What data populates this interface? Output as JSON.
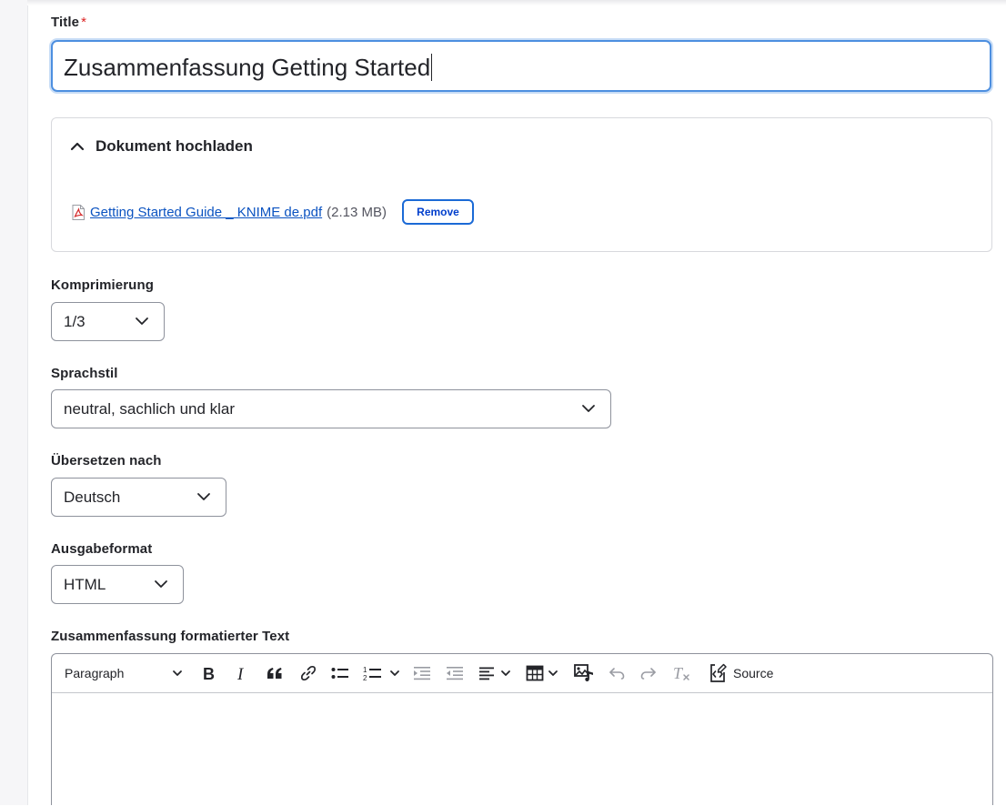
{
  "title_field": {
    "label": "Title",
    "required_mark": "*",
    "value": "Zusammenfassung Getting Started"
  },
  "upload": {
    "header": "Dokument hochladen",
    "file_name": "Getting Started Guide _ KNIME de.pdf",
    "file_size": "(2.13 MB)",
    "remove_label": "Remove"
  },
  "komprimierung": {
    "label": "Komprimierung",
    "value": "1/3"
  },
  "sprachstil": {
    "label": "Sprachstil",
    "value": "neutral, sachlich und klar"
  },
  "uebersetzen": {
    "label": "Übersetzen nach",
    "value": "Deutsch"
  },
  "ausgabeformat": {
    "label": "Ausgabeformat",
    "value": "HTML"
  },
  "editor": {
    "label": "Zusammenfassung formatierter Text",
    "paragraph_label": "Paragraph",
    "source_label": "Source"
  },
  "colors": {
    "accent": "#1b6ad6",
    "link": "#0b53c1",
    "required": "#dc2323",
    "focus_border": "#4d8fe0"
  }
}
